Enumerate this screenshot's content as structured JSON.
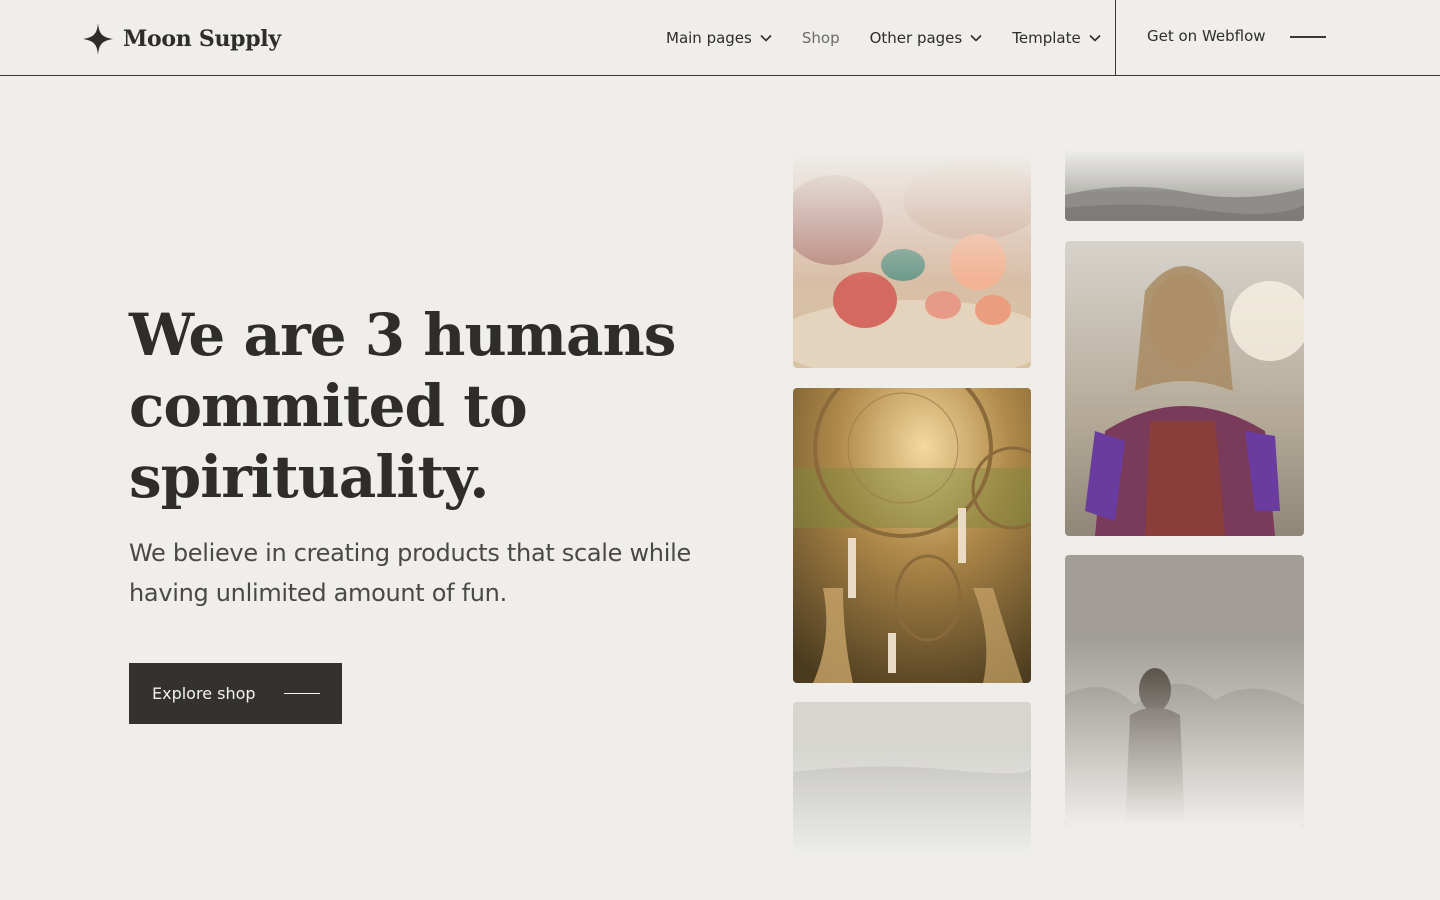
{
  "brand": {
    "name": "Moon Supply",
    "logo_icon": "four-point-star-icon"
  },
  "nav": {
    "items": [
      {
        "label": "Main pages",
        "dropdown": true
      },
      {
        "label": "Shop",
        "dropdown": false
      },
      {
        "label": "Other pages",
        "dropdown": true
      },
      {
        "label": "Template",
        "dropdown": true
      }
    ],
    "cta": "Get on Webflow",
    "menu_icon": "line-menu-icon"
  },
  "hero": {
    "title_lines": [
      "We are 3 humans",
      "commited to",
      "spirituality."
    ],
    "subtitle": "We believe in creating products that scale while having unlimited amount of fun.",
    "button_label": "Explore shop"
  },
  "gallery": [
    {
      "subject": "crystals-photo"
    },
    {
      "subject": "landscape-photo-top"
    },
    {
      "subject": "woman-with-feather-photo"
    },
    {
      "subject": "dreamcatcher-photo"
    },
    {
      "subject": "woman-mountains-photo"
    },
    {
      "subject": "misty-landscape-photo"
    }
  ],
  "colors": {
    "background": "#efeeea",
    "text": "#2e2d2b",
    "button": "#33322f",
    "border": "#3a3936"
  }
}
